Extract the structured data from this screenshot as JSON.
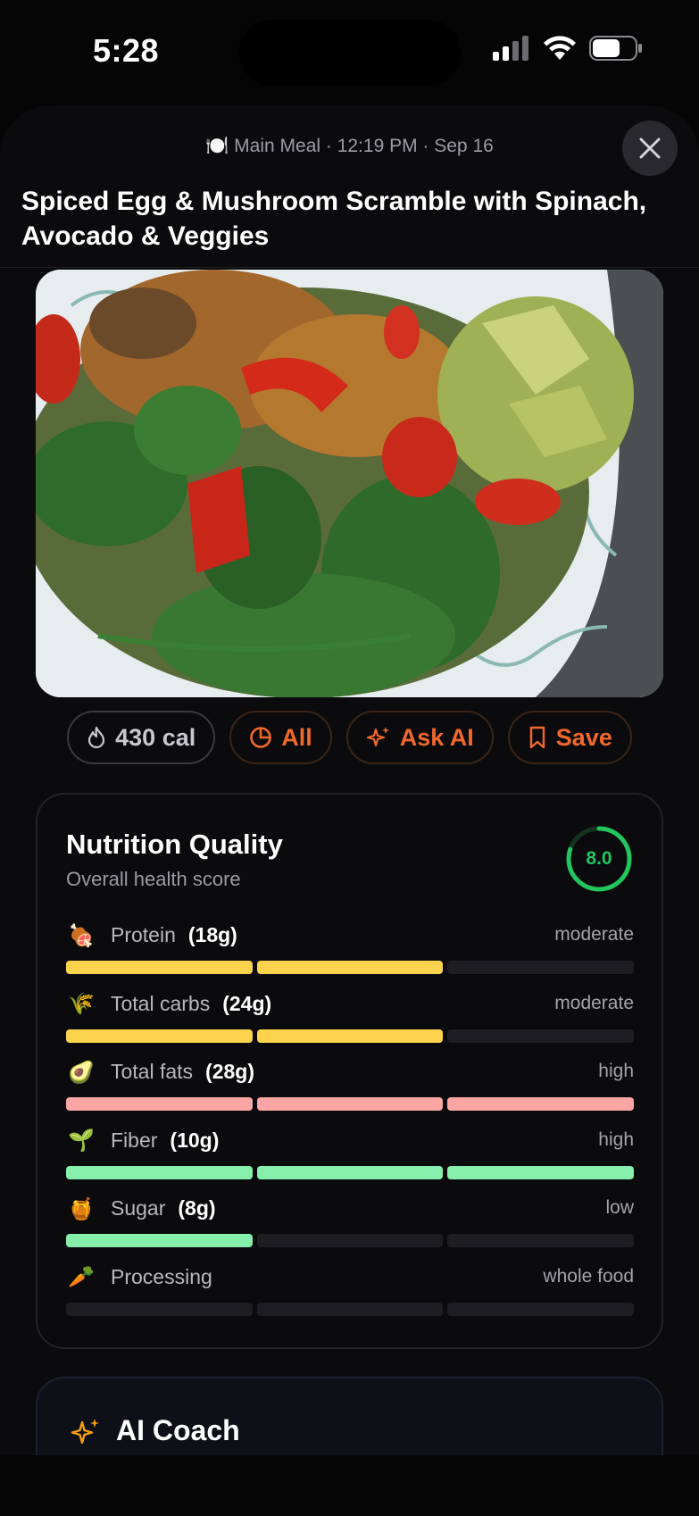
{
  "status_bar": {
    "time": "5:28"
  },
  "header": {
    "meta": "🍽️ Main Meal · 12:19 PM · Sep 16",
    "title": "Spiced Egg & Mushroom Scramble with Spinach, Avocado & Veggies",
    "close_icon": "close-icon"
  },
  "photo": {
    "description_icon": "meal-photo"
  },
  "actions": {
    "calories": "430 cal",
    "all": "All",
    "ask_ai": "Ask AI",
    "save": "Save"
  },
  "nutrition": {
    "title": "Nutrition Quality",
    "subtitle": "Overall health score",
    "score": "8.0",
    "score_fraction": 0.8,
    "items": [
      {
        "emoji": "🍖",
        "label": "Protein",
        "amount": "(18g)",
        "level": "moderate",
        "filled": 2,
        "color": "#fcd34d"
      },
      {
        "emoji": "🌾",
        "label": "Total carbs",
        "amount": "(24g)",
        "level": "moderate",
        "filled": 2,
        "color": "#fcd34d"
      },
      {
        "emoji": "🥑",
        "label": "Total fats",
        "amount": "(28g)",
        "level": "high",
        "filled": 3,
        "color": "#fca5a5"
      },
      {
        "emoji": "🌱",
        "label": "Fiber",
        "amount": "(10g)",
        "level": "high",
        "filled": 3,
        "color": "#86efac"
      },
      {
        "emoji": "🍯",
        "label": "Sugar",
        "amount": "(8g)",
        "level": "low",
        "filled": 1,
        "color": "#86efac"
      },
      {
        "emoji": "🥕",
        "label": "Processing",
        "amount": "",
        "level": "whole food",
        "filled": 0,
        "color": "#86efac"
      }
    ]
  },
  "coach": {
    "title": "AI Coach"
  },
  "colors": {
    "accent": "#f0682c",
    "score": "#22c55e",
    "background": "#0b0b0d"
  }
}
